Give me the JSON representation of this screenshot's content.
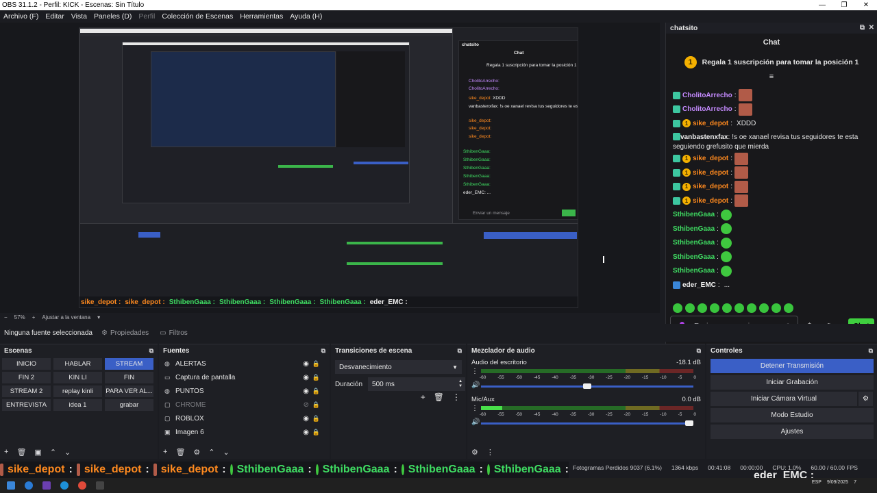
{
  "window": {
    "title": "OBS 31.1.2 - Perfil: KICK - Escenas: Sin Título",
    "min": "—",
    "max": "❐",
    "close": "✕"
  },
  "menu": [
    {
      "label": "Archivo (F)",
      "disabled": false
    },
    {
      "label": "Editar",
      "disabled": false
    },
    {
      "label": "Vista",
      "disabled": false
    },
    {
      "label": "Paneles (D)",
      "disabled": false
    },
    {
      "label": "Perfil",
      "disabled": true
    },
    {
      "label": "Colección de Escenas",
      "disabled": false
    },
    {
      "label": "Herramientas",
      "disabled": false
    },
    {
      "label": "Ayuda (H)",
      "disabled": false
    }
  ],
  "zoom": {
    "percent": "57%",
    "minus": "−",
    "plus": "+",
    "fit": "Ajustar a la ventana"
  },
  "chat": {
    "dock_title": "chatsito",
    "title": "Chat",
    "pinned": "Regala 1 suscripción para tomar la posición 1",
    "messages": [
      {
        "user": "CholitoArrecho",
        "text": "",
        "color": "purple",
        "badge": "green",
        "emote": "face"
      },
      {
        "user": "CholitoArrecho",
        "text": "",
        "color": "purple",
        "badge": "green",
        "emote": "face"
      },
      {
        "user": "sike_depot",
        "text": "XDDD",
        "color": "orange",
        "badge": "green",
        "emote": ""
      },
      {
        "user": "vanbastenxfax",
        "text": "!s oe xanael revisa tus seguidores te esta seguiendo grefusito que mierda",
        "color": "white",
        "badge": "green",
        "emote": "",
        "wrap": true
      },
      {
        "user": "sike_depot",
        "text": "",
        "color": "orange",
        "badge": "green",
        "emote": "face"
      },
      {
        "user": "sike_depot",
        "text": "",
        "color": "orange",
        "badge": "green",
        "emote": "face"
      },
      {
        "user": "sike_depot",
        "text": "",
        "color": "orange",
        "badge": "green",
        "emote": "face"
      },
      {
        "user": "sike_depot",
        "text": "",
        "color": "orange",
        "badge": "green",
        "emote": "face"
      },
      {
        "user": "SthibenGaaa",
        "text": "",
        "color": "green",
        "badge": "",
        "emote": "green"
      },
      {
        "user": "SthibenGaaa",
        "text": "",
        "color": "green",
        "badge": "",
        "emote": "green"
      },
      {
        "user": "SthibenGaaa",
        "text": "",
        "color": "green",
        "badge": "",
        "emote": "green"
      },
      {
        "user": "SthibenGaaa",
        "text": "",
        "color": "green",
        "badge": "",
        "emote": "green"
      },
      {
        "user": "SthibenGaaa",
        "text": "",
        "color": "green",
        "badge": "",
        "emote": "green"
      },
      {
        "user": "eder_EMC",
        "text": "...",
        "color": "white",
        "badge": "blue",
        "emote": ""
      }
    ],
    "input_placeholder": "Enviar un mensaje",
    "send": "Chat"
  },
  "properties_bar": {
    "no_source": "Ninguna fuente seleccionada",
    "properties": "Propiedades",
    "filters": "Filtros"
  },
  "scenes": {
    "title": "Escenas",
    "items": [
      {
        "label": "INICIO",
        "active": false
      },
      {
        "label": "HABLAR",
        "active": false
      },
      {
        "label": "STREAM",
        "active": true
      },
      {
        "label": "FIN 2",
        "active": false
      },
      {
        "label": "KIN LI",
        "active": false
      },
      {
        "label": "FIN",
        "active": false
      },
      {
        "label": "STREAM 2",
        "active": false
      },
      {
        "label": "replay kinli",
        "active": false
      },
      {
        "label": "PARA VER AL...",
        "active": false
      },
      {
        "label": "ENTREVISTA",
        "active": false
      },
      {
        "label": "idea 1",
        "active": false
      },
      {
        "label": "grabar",
        "active": false
      }
    ]
  },
  "sources": {
    "title": "Fuentes",
    "items": [
      {
        "label": "ALERTAS",
        "icon": "globe-icon",
        "visible": true
      },
      {
        "label": "Captura de pantalla",
        "icon": "monitor-icon",
        "visible": true
      },
      {
        "label": "PUNTOS",
        "icon": "globe-icon",
        "visible": true
      },
      {
        "label": "CHROME",
        "icon": "window-icon",
        "visible": false
      },
      {
        "label": "ROBLOX",
        "icon": "window-icon",
        "visible": true
      },
      {
        "label": "Imagen 6",
        "icon": "image-icon",
        "visible": true
      }
    ]
  },
  "transitions": {
    "title": "Transiciones de escena",
    "selected": "Desvanecimiento",
    "duration_label": "Duración",
    "duration_value": "500 ms"
  },
  "mixer": {
    "title": "Mezclador de audio",
    "channels": [
      {
        "name": "Audio del escritorio",
        "db": "-18.1 dB",
        "level": 0.0,
        "volume": 0.52
      },
      {
        "name": "Mic/Aux",
        "db": "0.0 dB",
        "level": 0.1,
        "volume": 1.0
      }
    ],
    "ticks": [
      "-60",
      "-55",
      "-50",
      "-45",
      "-40",
      "-35",
      "-30",
      "-25",
      "-20",
      "-15",
      "-10",
      "-5",
      "0"
    ]
  },
  "controls": {
    "title": "Controles",
    "stop_stream": "Detener Transmisión",
    "start_record": "Iniciar Grabación",
    "virtual_cam": "Iniciar Cámara Virtual",
    "studio": "Modo Estudio",
    "settings": "Ajustes"
  },
  "status": {
    "dropped": "Fotogramas Perdidos 9037 (6.1%)",
    "kbps": "1364 kbps",
    "stream_time": "00:41:08",
    "rec_time": "00:00:00",
    "cpu": "CPU: 1.0%",
    "fps": "60.00 / 60.00 FPS"
  },
  "ticker": [
    {
      "user": "sike_depot",
      "color": "orange"
    },
    {
      "user": "sike_depot",
      "color": "orange"
    },
    {
      "user": "sike_depot",
      "color": "orange"
    },
    {
      "user": "SthibenGaaa",
      "color": "green"
    },
    {
      "user": "SthibenGaaa",
      "color": "green"
    },
    {
      "user": "SthibenGaaa",
      "color": "green"
    },
    {
      "user": "SthibenGaaa",
      "color": "green"
    }
  ],
  "overlay_right": "eder_EMC :",
  "taskbar": {
    "lang": "ESP",
    "date": "9/09/2025",
    "badge": "7"
  }
}
